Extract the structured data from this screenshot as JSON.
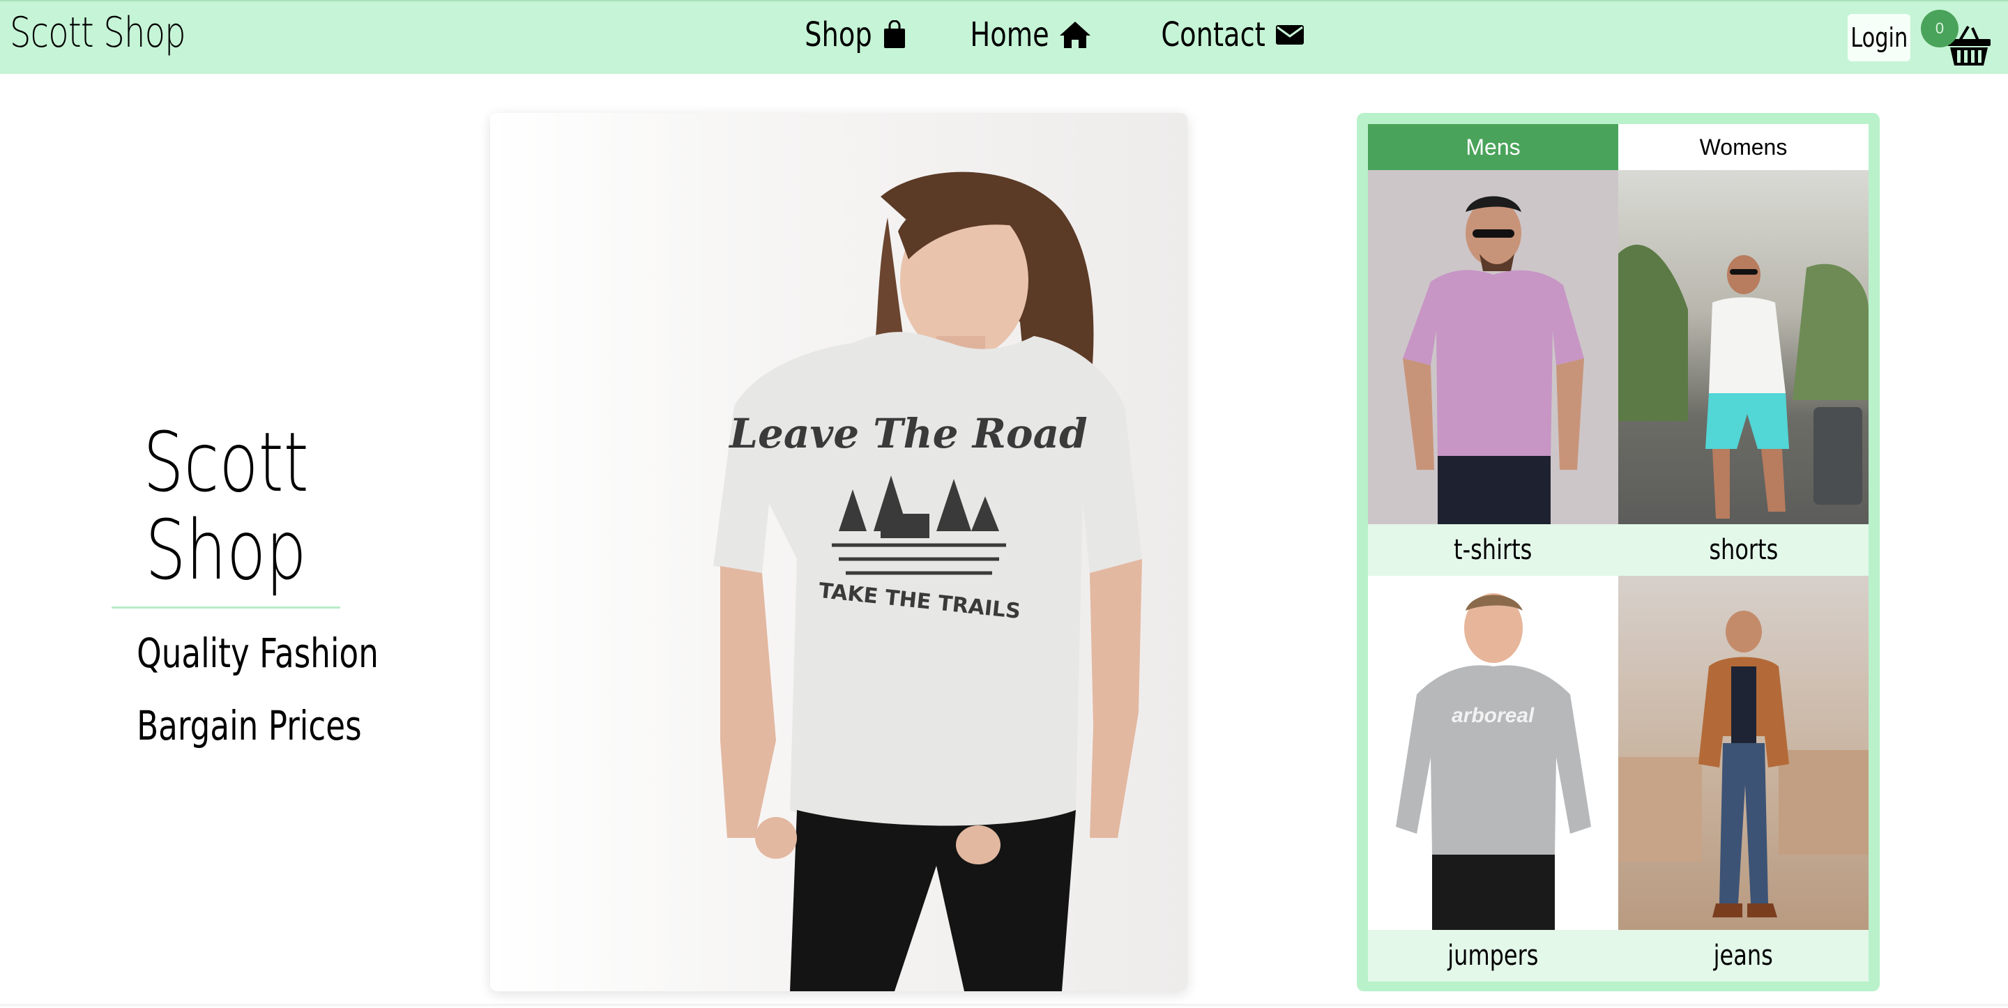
{
  "brand": "Scott Shop",
  "nav": {
    "links": [
      {
        "label": "Shop",
        "icon": "shopping-bag-icon"
      },
      {
        "label": "Home",
        "icon": "home-icon"
      },
      {
        "label": "Contact",
        "icon": "envelope-icon"
      }
    ],
    "login": "Login",
    "cart_count": "0"
  },
  "hero": {
    "title_line1": "Scott",
    "title_line2": "Shop",
    "tagline1": "Quality Fashion",
    "tagline2": "Bargain Prices"
  },
  "main_photo": {
    "shirt_text_top": "Leave The Road",
    "shirt_text_bottom": "TAKE THE TRAILS"
  },
  "categories": {
    "tabs": [
      "Mens",
      "Womens"
    ],
    "active_tab": "Mens",
    "items": [
      {
        "label": "t-shirts"
      },
      {
        "label": "shorts"
      },
      {
        "label": "jumpers",
        "shirt_text": "arboreal"
      },
      {
        "label": "jeans"
      }
    ]
  },
  "colors": {
    "navbar": "#c6f4d6",
    "accent": "#4aa35a",
    "panel": "#b9f1cb",
    "label_bg": "#e4f8ea"
  }
}
